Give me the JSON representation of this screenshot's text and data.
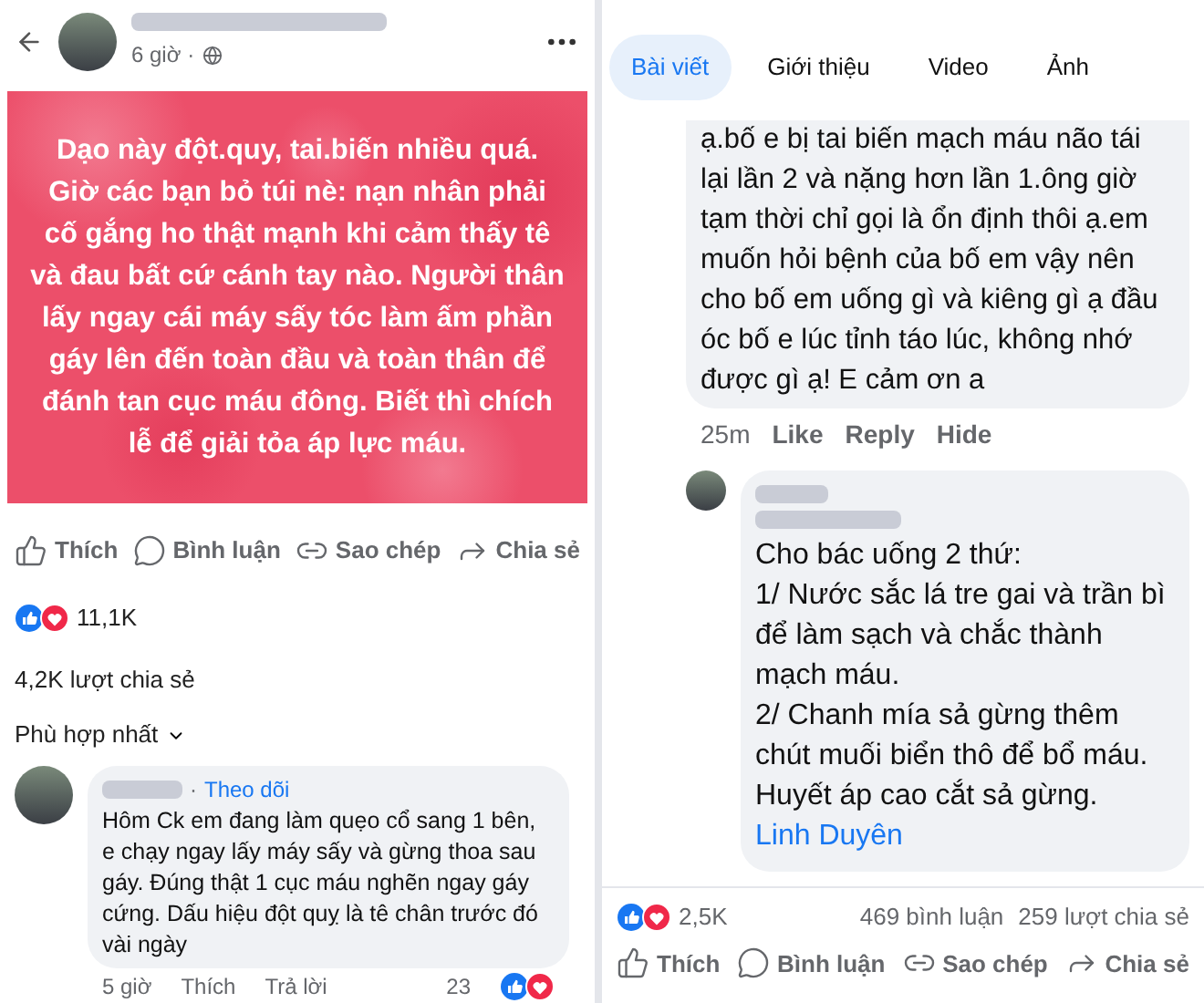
{
  "left": {
    "post_time": "6 giờ",
    "separator": "·",
    "post_text": "Dạo này đột.quy, tai.biến nhiều quá. Giờ các bạn bỏ túi nè: nạn nhân phải cố gắng ho thật mạnh khi cảm thấy tê và đau bất cứ cánh tay nào. Người thân lấy ngay cái máy sấy tóc làm ấm phần gáy lên đến toàn đầu và toàn thân để đánh tan cục máu đông. Biết thì chích lễ để giải tỏa áp lực máu.",
    "actions": [
      {
        "kind": "like",
        "label": "Thích"
      },
      {
        "kind": "comment",
        "label": "Bình luận"
      },
      {
        "kind": "copy",
        "label": "Sao chép"
      },
      {
        "kind": "share",
        "label": "Chia sẻ"
      }
    ],
    "reaction_count": "11,1K",
    "shares": "4,2K lượt chia sẻ",
    "sort": "Phù hợp nhất",
    "comment": {
      "separator": "·",
      "follow": "Theo dõi",
      "text": "Hôm Ck em đang làm quẹo cổ sang 1 bên, e chạy ngay lấy máy sấy và gừng thoa sau gáy. Đúng thật 1 cục máu nghẽn ngay gáy cứng. Dấu hiệu đột quỵ là tê chân trước đó vài ngày",
      "time": "5 giờ",
      "like": "Thích",
      "reply": "Trả lời",
      "reaction_count": "23"
    }
  },
  "right": {
    "tabs": [
      {
        "label": "Bài viết",
        "selected": true
      },
      {
        "label": "Giới thiệu",
        "selected": false
      },
      {
        "label": "Video",
        "selected": false
      },
      {
        "label": "Ảnh",
        "selected": false
      }
    ],
    "comment": {
      "text": "ạ.bố e bị tai biến mạch máu não tái lại lần 2 và nặng hơn lần 1.ông giờ tạm thời chỉ gọi là ổn định thôi ạ.em muốn hỏi bệnh của bố em vậy nên  cho bố em uống gì và kiêng gì ạ đầu óc bố e lúc tỉnh táo lúc, không nhớ được gì ạ! E cảm ơn a",
      "time": "25m",
      "actions": [
        "Like",
        "Reply",
        "Hide"
      ]
    },
    "reply": {
      "lines": [
        "Cho bác uống 2 thứ:",
        "1/ Nước sắc lá tre gai và trần bì để làm sạch và chắc thành mạch máu.",
        "2/ Chanh mía sả gừng thêm chút muối biển thô để bổ máu. Huyết áp cao cắt sả gừng."
      ],
      "mention": "Linh Duyên"
    },
    "reaction_count": "2,5K",
    "comments": "469 bình luận",
    "shares": "259 lượt chia sẻ",
    "actions": [
      {
        "kind": "like",
        "label": "Thích"
      },
      {
        "kind": "comment",
        "label": "Bình luận"
      },
      {
        "kind": "copy",
        "label": "Sao chép"
      },
      {
        "kind": "share",
        "label": "Chia sẻ"
      }
    ]
  }
}
